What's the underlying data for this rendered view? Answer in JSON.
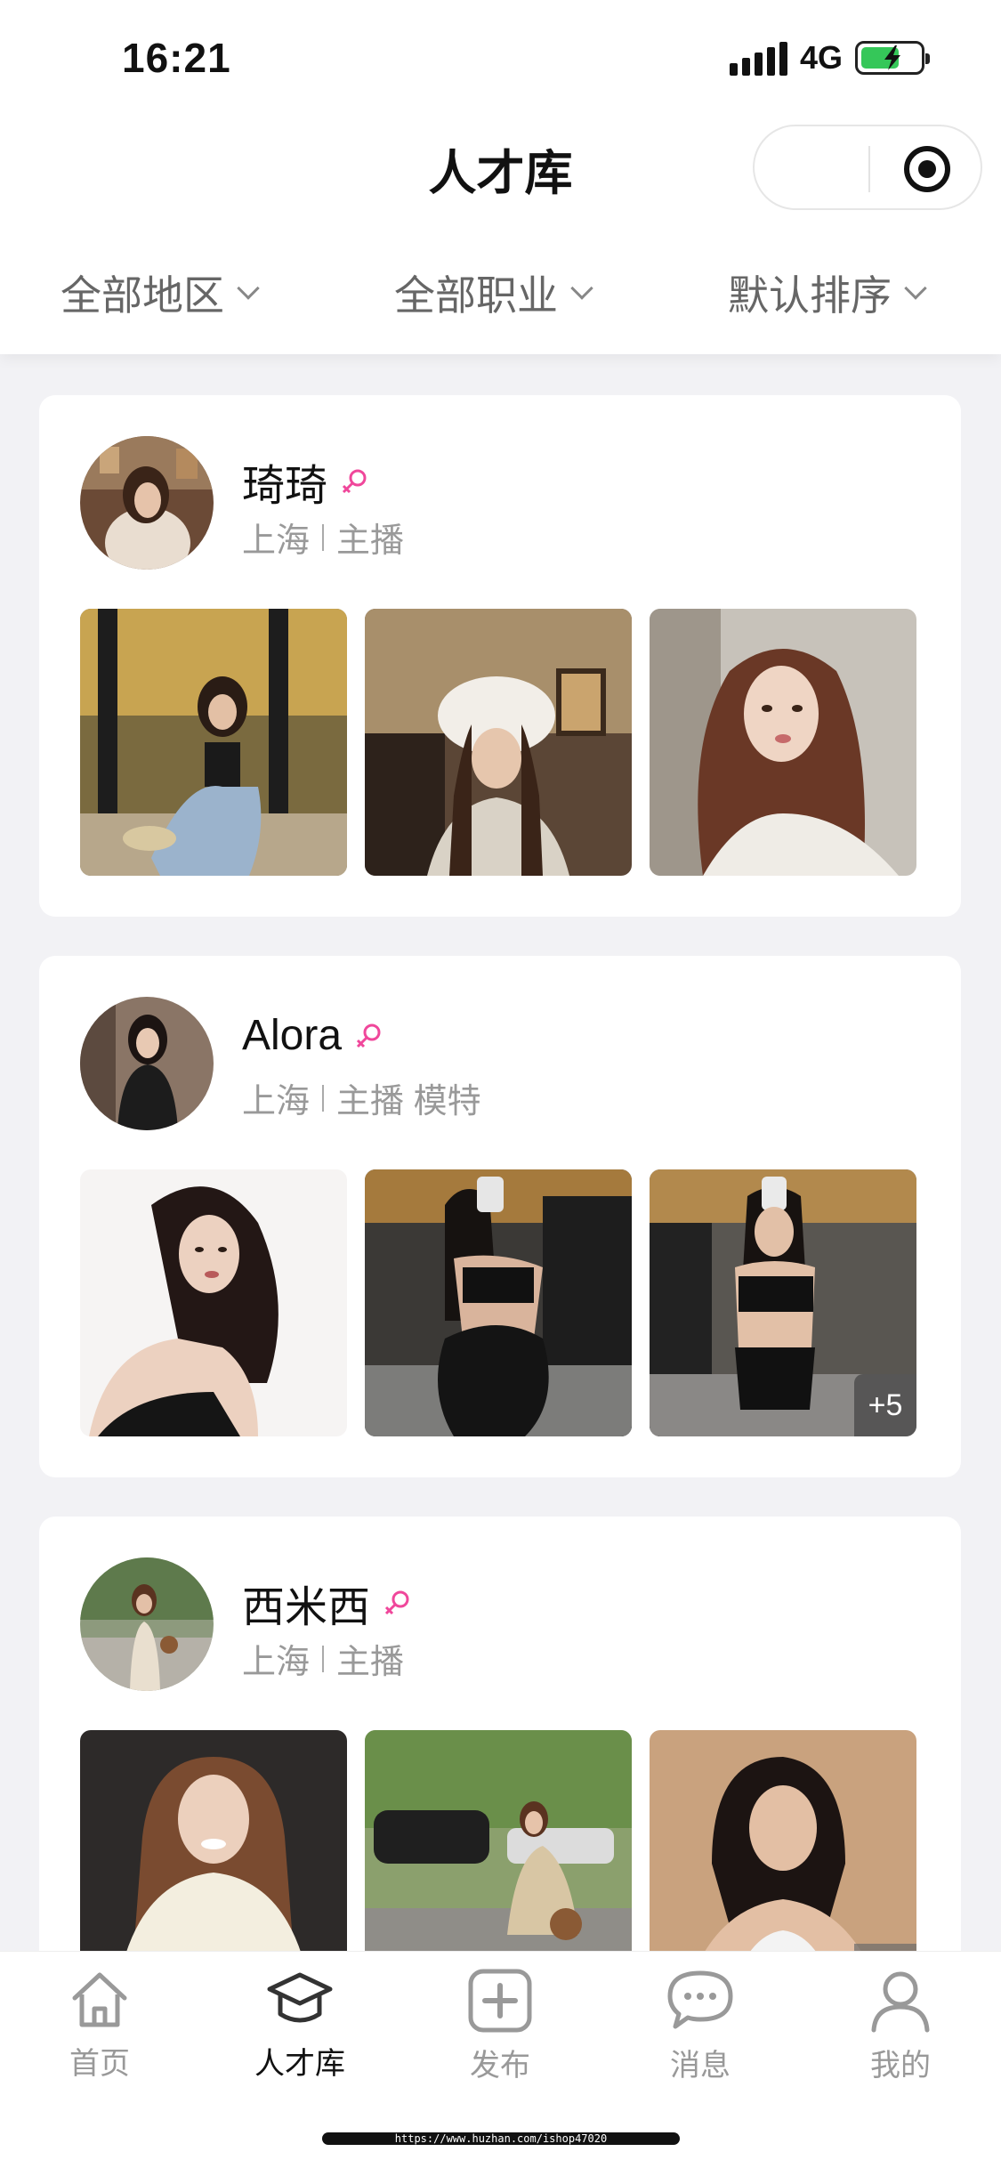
{
  "status_bar": {
    "time": "16:21",
    "network": "4G"
  },
  "header": {
    "title": "人才库"
  },
  "filters": [
    {
      "label": "全部地区"
    },
    {
      "label": "全部职业"
    },
    {
      "label": "默认排序"
    }
  ],
  "talents": [
    {
      "name": "琦琦",
      "gender": "female",
      "city": "上海",
      "roles": "主播",
      "photos": [
        "photo-1",
        "photo-2",
        "photo-3"
      ],
      "more_count": ""
    },
    {
      "name": "Alora",
      "gender": "female",
      "city": "上海",
      "roles": "主播 模特",
      "photos": [
        "photo-1",
        "photo-2",
        "photo-3"
      ],
      "more_count": "+5"
    },
    {
      "name": "西米西",
      "gender": "female",
      "city": "上海",
      "roles": "主播",
      "photos": [
        "photo-1",
        "photo-2",
        "photo-3"
      ],
      "more_count": ""
    }
  ],
  "tabbar": [
    {
      "label": "首页",
      "icon": "home-icon",
      "active": false
    },
    {
      "label": "人才库",
      "icon": "graduation-cap-icon",
      "active": true
    },
    {
      "label": "发布",
      "icon": "plus-square-icon",
      "active": false
    },
    {
      "label": "消息",
      "icon": "chat-bubble-icon",
      "active": false
    },
    {
      "label": "我的",
      "icon": "user-icon",
      "active": false
    }
  ],
  "watermark": "https://www.huzhan.com/ishop47020",
  "colors": {
    "accent_female": "#f0479b",
    "battery": "#35c759"
  }
}
